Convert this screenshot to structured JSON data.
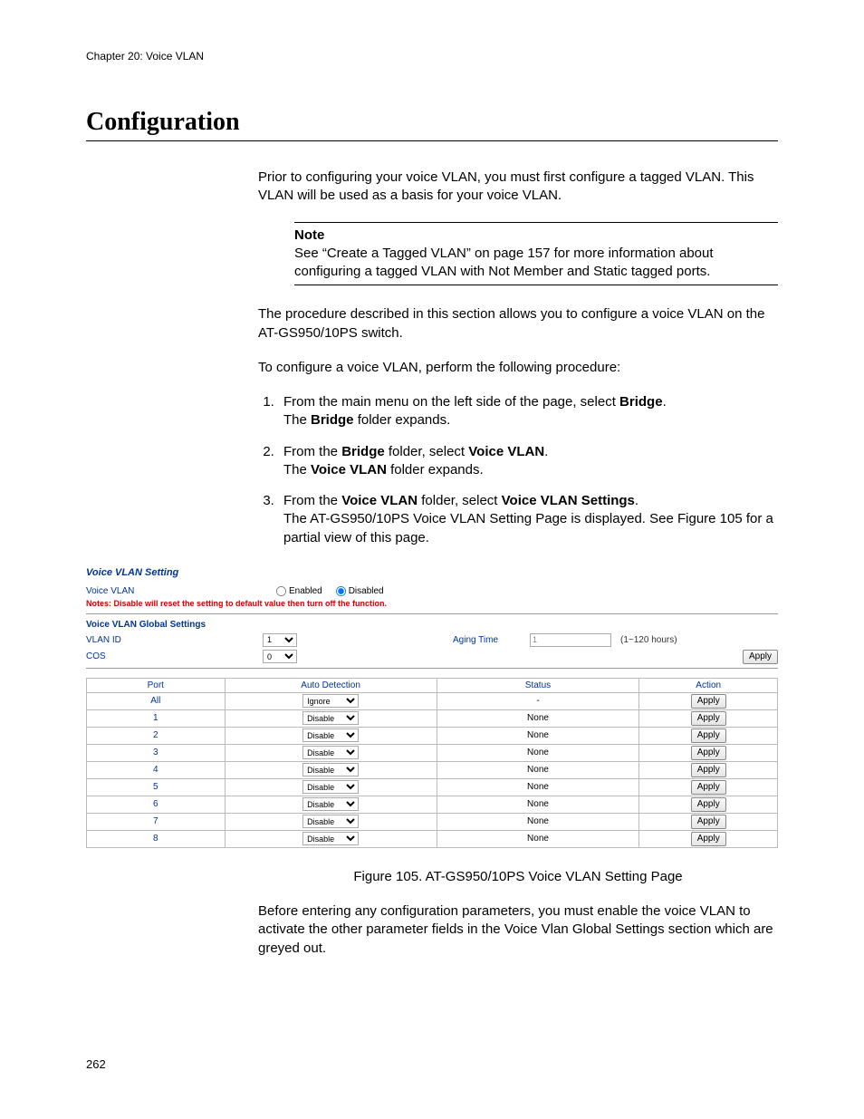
{
  "chapter": "Chapter 20: Voice VLAN",
  "section_title": "Configuration",
  "intro1": "Prior to configuring your voice VLAN, you must first configure a tagged VLAN. This VLAN will be used as a basis for your voice VLAN.",
  "note": {
    "label": "Note",
    "text": "See “Create a Tagged VLAN” on page 157 for more information about configuring a tagged VLAN with Not Member and Static tagged ports."
  },
  "para2": "The procedure described in this section allows you to configure a voice VLAN on the AT-GS950/10PS switch.",
  "para3": "To configure a voice VLAN, perform the following procedure:",
  "steps": {
    "s1a": "From the main menu on the left side of the page, select ",
    "s1b": "Bridge",
    "s1c": ".",
    "s1d": "The ",
    "s1e": "Bridge",
    "s1f": " folder expands.",
    "s2a": "From the ",
    "s2b": "Bridge",
    "s2c": " folder, select ",
    "s2d": "Voice VLAN",
    "s2e": ".",
    "s2f": "The ",
    "s2g": "Voice VLAN",
    "s2h": " folder expands.",
    "s3a": "From the ",
    "s3b": "Voice VLAN",
    "s3c": " folder, select ",
    "s3d": "Voice VLAN Settings",
    "s3e": ".",
    "s3f": "The AT-GS950/10PS Voice VLAN Setting Page is displayed. See Figure 105 for a partial view of this page."
  },
  "fig": {
    "title": "Voice VLAN Setting",
    "voice_vlan_label": "Voice VLAN",
    "enabled": "Enabled",
    "disabled": "Disabled",
    "warning": "Notes: Disable will reset the setting to default value then turn off the function.",
    "global_title": "Voice VLAN Global Settings",
    "vlan_id_label": "VLAN ID",
    "vlan_id_value": "1",
    "aging_label": "Aging Time",
    "aging_value": "1",
    "aging_range": "(1~120 hours)",
    "cos_label": "COS",
    "cos_value": "0",
    "apply": "Apply",
    "headers": {
      "port": "Port",
      "auto": "Auto Detection",
      "status": "Status",
      "action": "Action"
    },
    "row_all": {
      "port": "All",
      "auto": "Ignore",
      "status": "-"
    },
    "rows": [
      {
        "port": "1",
        "auto": "Disable",
        "status": "None"
      },
      {
        "port": "2",
        "auto": "Disable",
        "status": "None"
      },
      {
        "port": "3",
        "auto": "Disable",
        "status": "None"
      },
      {
        "port": "4",
        "auto": "Disable",
        "status": "None"
      },
      {
        "port": "5",
        "auto": "Disable",
        "status": "None"
      },
      {
        "port": "6",
        "auto": "Disable",
        "status": "None"
      },
      {
        "port": "7",
        "auto": "Disable",
        "status": "None"
      },
      {
        "port": "8",
        "auto": "Disable",
        "status": "None"
      }
    ]
  },
  "figure_caption": "Figure 105. AT-GS950/10PS Voice VLAN Setting Page",
  "closing": "Before entering any configuration parameters, you must enable the voice VLAN to activate the other parameter fields in the Voice Vlan Global Settings section which are greyed out.",
  "page_number": "262"
}
